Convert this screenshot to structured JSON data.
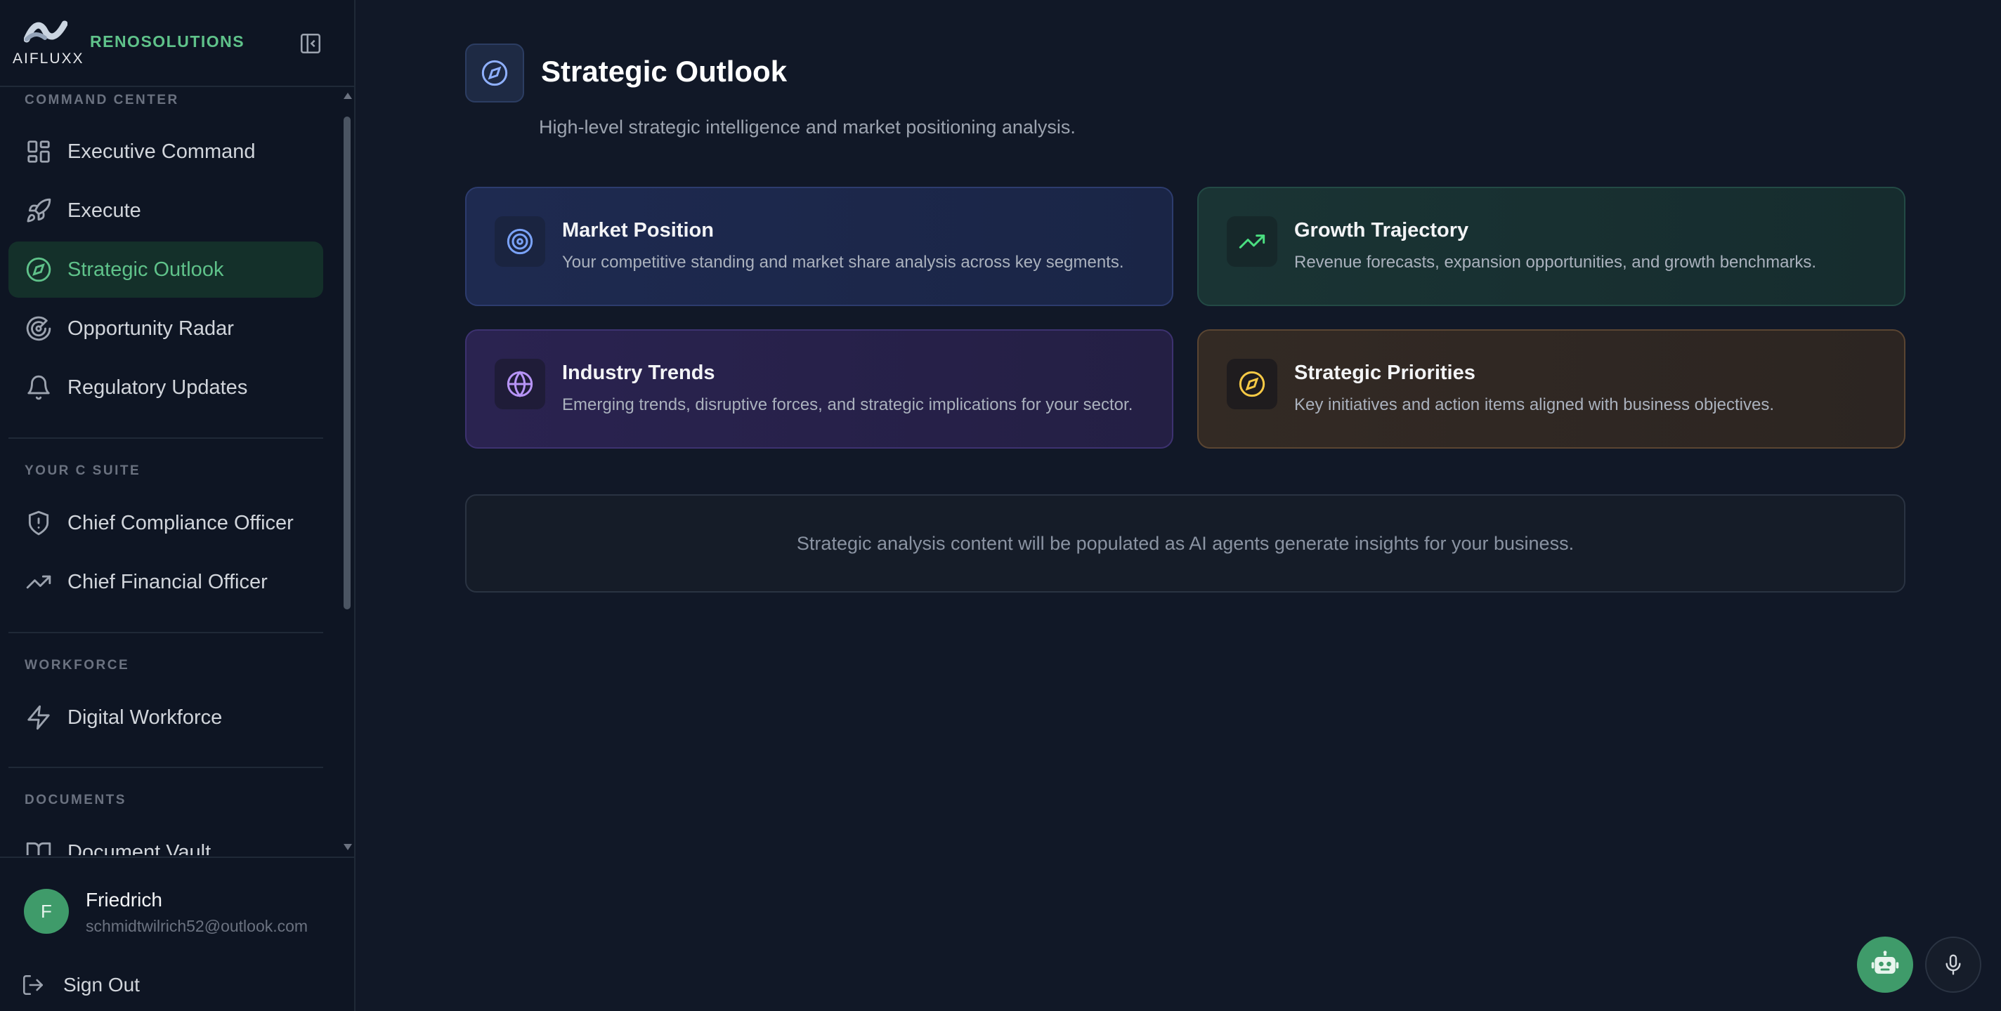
{
  "brand": {
    "logo_text": "AIFLUXX",
    "org_name": "RENOSOLUTIONS"
  },
  "sidebar": {
    "sections": [
      {
        "label": "COMMAND CENTER",
        "items": [
          {
            "label": "Executive Command",
            "icon": "grid-icon"
          },
          {
            "label": "Execute",
            "icon": "rocket-icon"
          },
          {
            "label": "Strategic Outlook",
            "icon": "compass-icon",
            "active": true
          },
          {
            "label": "Opportunity Radar",
            "icon": "radar-icon"
          },
          {
            "label": "Regulatory Updates",
            "icon": "bell-icon"
          }
        ]
      },
      {
        "label": "YOUR C SUITE",
        "items": [
          {
            "label": "Chief Compliance Officer",
            "icon": "shield-icon"
          },
          {
            "label": "Chief Financial Officer",
            "icon": "trending-up-icon"
          }
        ]
      },
      {
        "label": "WORKFORCE",
        "items": [
          {
            "label": "Digital Workforce",
            "icon": "lightning-icon"
          }
        ]
      },
      {
        "label": "DOCUMENTS",
        "items": [
          {
            "label": "Document Vault",
            "icon": "book-icon"
          }
        ]
      }
    ]
  },
  "user": {
    "initial": "F",
    "name": "Friedrich",
    "email": "schmidtwilrich52@outlook.com",
    "sign_out": "Sign Out"
  },
  "main": {
    "title": "Strategic Outlook",
    "subtitle": "High-level strategic intelligence and market positioning analysis.",
    "cards": [
      {
        "title": "Market Position",
        "desc": "Your competitive standing and market share analysis across key segments.",
        "icon": "target-icon",
        "accent": "#7aa2f7"
      },
      {
        "title": "Growth Trajectory",
        "desc": "Revenue forecasts, expansion opportunities, and growth benchmarks.",
        "icon": "trending-up-icon",
        "accent": "#4ade80"
      },
      {
        "title": "Industry Trends",
        "desc": "Emerging trends, disruptive forces, and strategic implications for your sector.",
        "icon": "globe-icon",
        "accent": "#b794f6"
      },
      {
        "title": "Strategic Priorities",
        "desc": "Key initiatives and action items aligned with business objectives.",
        "icon": "compass-icon",
        "accent": "#f6c945"
      }
    ],
    "placeholder": "Strategic analysis content will be populated as AI agents generate insights for your business."
  },
  "colors": {
    "background": "#111827",
    "sidebar": "#0e1523",
    "accent_green": "#5fc28a",
    "active_bg": "#14302a"
  }
}
